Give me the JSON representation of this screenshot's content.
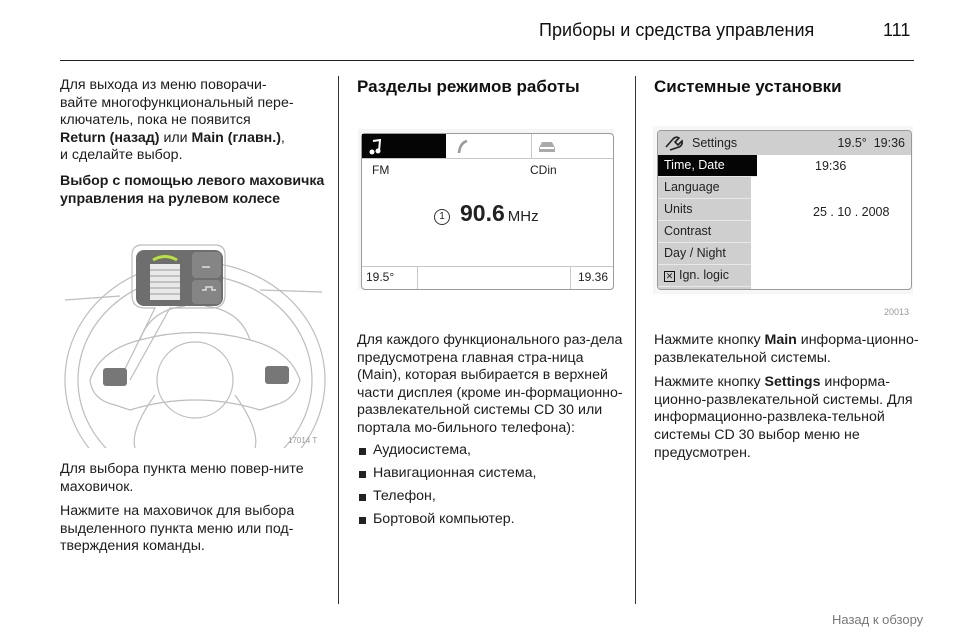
{
  "header": {
    "title": "Приборы и средства управления",
    "page_number": "111"
  },
  "left_column": {
    "intro": [
      "Для выхода из меню поворачи-",
      "вайте многофункциональный пере-",
      "ключатель, пока не появится"
    ],
    "return_label": "Return (назад)",
    "or_text": " или ",
    "main_label": "Main (главн.)",
    "comma": ",",
    "intro_end": "и сделайте выбор.",
    "subheading": "Выбор с помощью левого маховичка управления на рулевом колесе",
    "figure_code": "17014 T",
    "para_turn": "Для выбора пункта меню повер-ните маховичок.",
    "para_press": "Нажмите на маховичок для выбора выделенного пункта меню или под-тверждения команды."
  },
  "middle_column": {
    "heading": "Разделы режимов работы",
    "display": {
      "tabs": [
        {
          "icon": "music-note-icon",
          "active": true
        },
        {
          "icon": "phone-icon",
          "active": false
        },
        {
          "icon": "car-icon",
          "active": false
        }
      ],
      "source_left": "FM",
      "source_right": "CDin",
      "preset": "1",
      "frequency": "90.6",
      "unit": "MHz",
      "temperature": "19.5°",
      "time": "19.36"
    },
    "paragraph": "Для каждого функционального раз-дела предусмотрена главная стра-ница (Main), которая выбирается в верхней части дисплея (кроме ин-формационно-развлекательной системы CD 30 или портала мо-бильного телефона):",
    "bullets": [
      "Аудиосистема,",
      "Навигационная система,",
      "Телефон,",
      "Бортовой компьютер."
    ]
  },
  "right_column": {
    "heading": "Системные установки",
    "display": {
      "title": "Settings",
      "temperature": "19.5°",
      "clock": "19:36",
      "menu": [
        "Time, Date",
        "Language",
        "Units",
        "Contrast",
        "Day / Night",
        "Ign. logic"
      ],
      "selected_index": 0,
      "value_time": "19:36",
      "value_date": "25 . 10 . 2008",
      "checkbox_mark": "✕"
    },
    "figure_code": "20013",
    "para1_pre": "Нажмите кнопку ",
    "para1_bold": "Main",
    "para1_post": " информа-ционно-развлекательной системы.",
    "para2_pre": "Нажмите кнопку ",
    "para2_bold": "Settings",
    "para2_post": " информа-ционно-развлекательной системы. Для информационно-развлека-тельной системы CD 30 выбор меню не предусмотрен."
  },
  "footer": {
    "back_link": "Назад к обзору"
  }
}
